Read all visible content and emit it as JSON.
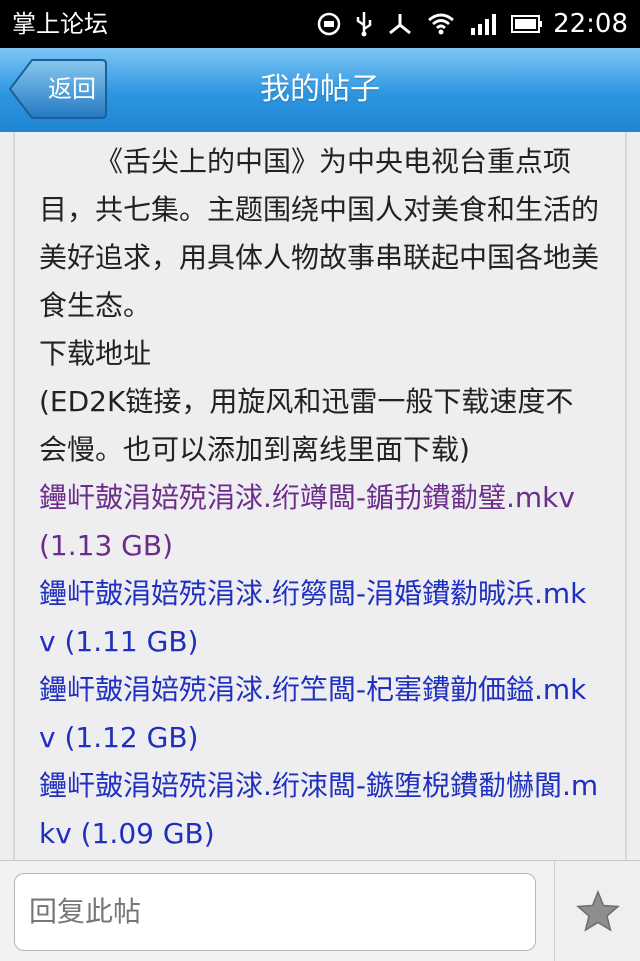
{
  "statusbar": {
    "app_name": "掌上论坛",
    "time": "22:08",
    "icons": [
      "notification-m-icon",
      "usb-icon",
      "share-icon",
      "wifi-icon",
      "signal-icon",
      "battery-icon"
    ]
  },
  "header": {
    "back_label": "返回",
    "title": "我的帖子"
  },
  "post": {
    "paragraphs": [
      "《舌尖上的中国》为中央电视台重点项目，共七集。主题围绕中国人对美食和生活的美好追求，用具体人物故事串联起中国各地美食生态。",
      "下载地址",
      "(ED2K链接，用旋风和迅雷一般下载速度不会慢。也可以添加到离线里面下载)"
    ],
    "links": [
      {
        "text": "鑸屽皷涓婄殑涓浗.绗竴闆-鍎劧鐨勫璧.mkv (1.13 GB)",
        "visited": true
      },
      {
        "text": "鑸屽皷涓婄殑涓浗.绗簩闆-涓婚鐨勬晠浜.mkv (1.11 GB)",
        "visited": false
      },
      {
        "text": "鑸屽皷涓婄殑涓浗.绗笁闆-杞寚鐨勭価鎰.mkv (1.12 GB)",
        "visited": false
      },
      {
        "text": "鑸屽皷涓婄殑涓浗.绗洓闆-鏃堕棿鐨勫懗閬.mkv (1.09 GB)",
        "visited": false
      }
    ]
  },
  "reply": {
    "placeholder": "回复此帖"
  },
  "colors": {
    "header_top": "#7ec6f5",
    "header_bottom": "#1f86d4",
    "link_visited": "#6b2c8c",
    "link": "#1f2fbf",
    "content_bg": "#eeeef0"
  }
}
